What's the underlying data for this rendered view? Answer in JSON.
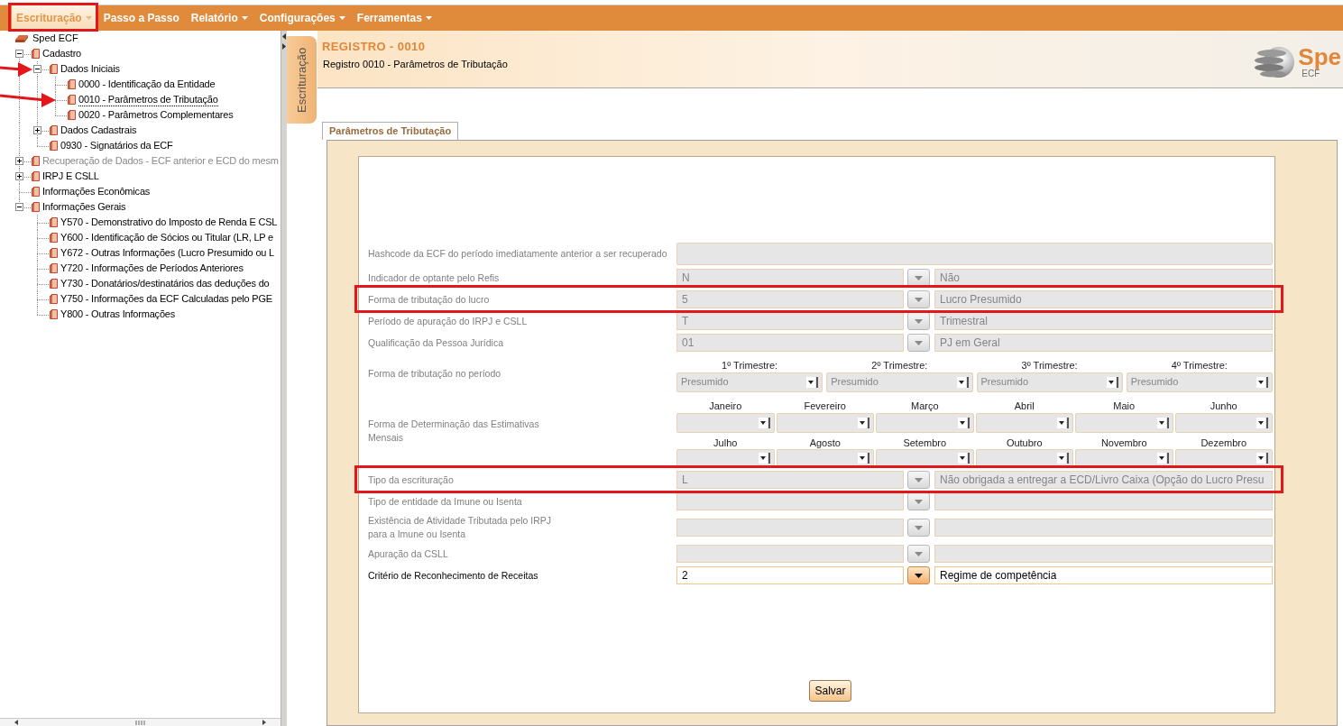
{
  "menu": [
    {
      "label": "Escrituração",
      "selected": true,
      "dropdown": true,
      "highlighted": true
    },
    {
      "label": "Passo a Passo",
      "selected": false,
      "dropdown": false,
      "highlighted": false
    },
    {
      "label": "Relatório",
      "selected": false,
      "dropdown": true,
      "highlighted": false
    },
    {
      "label": "Configurações",
      "selected": false,
      "dropdown": true,
      "highlighted": false
    },
    {
      "label": "Ferramentas",
      "selected": false,
      "dropdown": true,
      "highlighted": false
    }
  ],
  "tree": {
    "title": "Sped ECF",
    "items": [
      {
        "label": "Cadastro",
        "expanded": true,
        "selected": false,
        "disabled": false,
        "arrow": false,
        "children": [
          {
            "label": "Dados Iniciais",
            "expanded": true,
            "selected": false,
            "disabled": false,
            "arrow": true,
            "children": [
              {
                "label": "0000 - Identificação da Entidade",
                "selected": false,
                "disabled": false,
                "arrow": false
              },
              {
                "label": "0010 - Parâmetros de Tributação",
                "selected": true,
                "disabled": false,
                "arrow": true
              },
              {
                "label": "0020 - Parâmetros Complementares",
                "selected": false,
                "disabled": false,
                "arrow": false
              }
            ]
          },
          {
            "label": "Dados Cadastrais",
            "expanded": false,
            "selected": false,
            "disabled": false,
            "arrow": false
          },
          {
            "label": "0930 - Signatários da ECF",
            "selected": false,
            "disabled": false,
            "arrow": false
          }
        ]
      },
      {
        "label": "Recuperação de Dados - ECF anterior e ECD do mesm",
        "expanded": false,
        "selected": false,
        "disabled": true,
        "arrow": false
      },
      {
        "label": "IRPJ E CSLL",
        "expanded": false,
        "selected": false,
        "disabled": false,
        "arrow": false
      },
      {
        "label": "Informações Econômicas",
        "selected": false,
        "disabled": false,
        "arrow": false
      },
      {
        "label": "Informações Gerais",
        "expanded": true,
        "selected": false,
        "disabled": false,
        "arrow": false,
        "children": [
          {
            "label": "Y570 - Demonstrativo do Imposto de Renda E CSL",
            "selected": false,
            "disabled": false,
            "arrow": false
          },
          {
            "label": "Y600 - Identificação de Sócios ou Titular (LR, LP e",
            "selected": false,
            "disabled": false,
            "arrow": false
          },
          {
            "label": "Y672 - Outras Informações (Lucro Presumido ou L",
            "selected": false,
            "disabled": false,
            "arrow": false
          },
          {
            "label": "Y720 - Informações de Períodos Anteriores",
            "selected": false,
            "disabled": false,
            "arrow": false
          },
          {
            "label": "Y730 - Donatários/destinatários das deduções do",
            "selected": false,
            "disabled": false,
            "arrow": false
          },
          {
            "label": "Y750 - Informações da ECF Calculadas pelo PGE",
            "selected": false,
            "disabled": false,
            "arrow": false
          },
          {
            "label": "Y800 - Outras Informações",
            "selected": false,
            "disabled": false,
            "arrow": false
          }
        ]
      }
    ]
  },
  "side_tab": {
    "label": "Escrituração"
  },
  "header": {
    "title": "REGISTRO - 0010",
    "subtitle": "Registro 0010 - Parâmetros de Tributação",
    "logo": {
      "text": "Spe",
      "subtext": "ECF"
    }
  },
  "form": {
    "tab": "Parâmetros de Tributação",
    "rows": [
      {
        "kind": "text",
        "label": "Hashcode da ECF do período imediatamente anterior a ser recuperado",
        "disabled": true,
        "highlighted": false
      },
      {
        "kind": "lookup",
        "label": "Indicador de optante pelo Refis",
        "code": "N",
        "description": "Não",
        "disabled": true,
        "highlighted": false
      },
      {
        "kind": "lookup",
        "label": "Forma de tributação do lucro",
        "code": "5",
        "description": "Lucro Presumido",
        "disabled": true,
        "highlighted": true
      },
      {
        "kind": "lookup",
        "label": "Período de apuração do IRPJ e CSLL",
        "code": "T",
        "description": "Trimestral",
        "disabled": true,
        "highlighted": false
      },
      {
        "kind": "lookup",
        "label": "Qualificação da Pessoa Jurídica",
        "code": "01",
        "description": "PJ em Geral",
        "disabled": true,
        "highlighted": false
      },
      {
        "kind": "quarters",
        "label": "Forma de tributação no período",
        "disabled": true,
        "highlighted": false,
        "periods": [
          {
            "label": "1º Trimestre:",
            "value": "Presumido"
          },
          {
            "label": "2º Trimestre:",
            "value": "Presumido"
          },
          {
            "label": "3º Trimestre:",
            "value": "Presumido"
          },
          {
            "label": "4º Trimestre:",
            "value": "Presumido"
          }
        ]
      },
      {
        "kind": "months",
        "label": "Forma de Determinação das Estimativas\nMensais",
        "disabled": true,
        "highlighted": false,
        "periods": [
          {
            "label": "Janeiro"
          },
          {
            "label": "Fevereiro"
          },
          {
            "label": "Março"
          },
          {
            "label": "Abril"
          },
          {
            "label": "Maio"
          },
          {
            "label": "Junho"
          },
          {
            "label": "Julho"
          },
          {
            "label": "Agosto"
          },
          {
            "label": "Setembro"
          },
          {
            "label": "Outubro"
          },
          {
            "label": "Novembro"
          },
          {
            "label": "Dezembro"
          }
        ]
      },
      {
        "kind": "lookup",
        "label": "Tipo da escrituração",
        "code": "L",
        "description": "Não obrigada a entregar a ECD/Livro Caixa (Opção do Lucro Presu",
        "disabled": true,
        "highlighted": true
      },
      {
        "kind": "lookup",
        "label": "Tipo de entidade da Imune ou Isenta",
        "disabled": true,
        "highlighted": false
      },
      {
        "kind": "lookup",
        "label": "Existência de Atividade Tributada pelo IRPJ\npara a Imune ou Isenta",
        "disabled": true,
        "highlighted": false
      },
      {
        "kind": "lookup",
        "label": "Apuração da CSLL",
        "disabled": true,
        "highlighted": false
      },
      {
        "kind": "lookup",
        "label": "Critério de Reconhecimento de Receitas",
        "code": "2",
        "description": "Regime de competência",
        "disabled": false,
        "highlighted": false
      }
    ],
    "save_button": "Salvar"
  }
}
